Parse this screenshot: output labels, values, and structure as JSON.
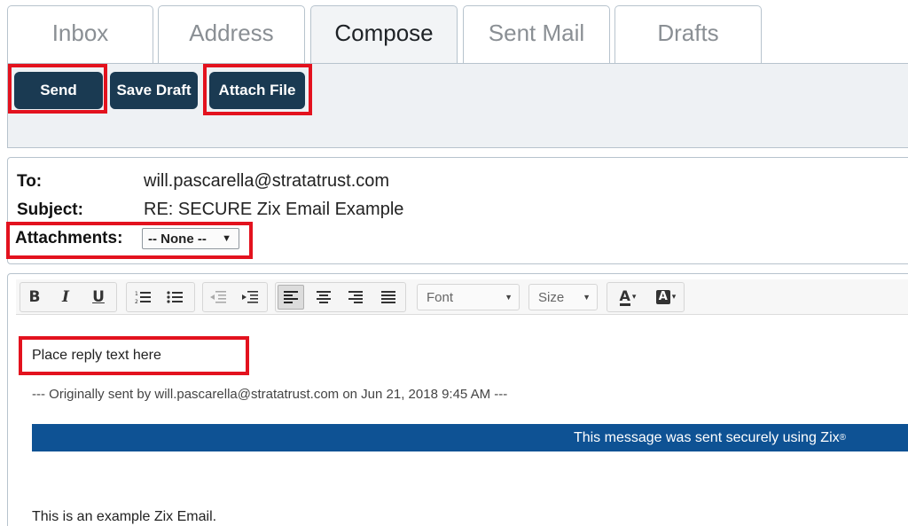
{
  "tabs": [
    {
      "label": "Inbox",
      "active": false
    },
    {
      "label": "Address",
      "active": false
    },
    {
      "label": "Compose",
      "active": true
    },
    {
      "label": "Sent Mail",
      "active": false
    },
    {
      "label": "Drafts",
      "active": false
    }
  ],
  "toolbar": {
    "send_label": "Send",
    "save_draft_label": "Save Draft",
    "attach_file_label": "Attach File"
  },
  "fields": {
    "to_label": "To:",
    "to_value": "will.pascarella@stratatrust.com",
    "subject_label": "Subject:",
    "subject_value": "RE: SECURE Zix Email Example",
    "attachments_label": "Attachments:",
    "attachments_selected": "-- None --"
  },
  "editor_toolbar": {
    "bold": "B",
    "italic": "I",
    "underline": "U",
    "font_dropdown": "Font",
    "size_dropdown": "Size",
    "text_color_glyph": "A",
    "bg_color_glyph": "A",
    "icons": [
      "ordered-list-icon",
      "unordered-list-icon",
      "outdent-icon",
      "indent-icon",
      "align-left-icon",
      "align-center-icon",
      "align-right-icon",
      "align-justify-icon",
      "text-color-icon",
      "background-color-icon"
    ]
  },
  "body": {
    "reply_placeholder": "Place reply text here",
    "original_header": "--- Originally sent by will.pascarella@stratatrust.com on Jun 21, 2018 9:45 AM ---",
    "banner_text": "This message was sent securely using Zix",
    "banner_mark": "®",
    "message_line": "This is an example Zix Email."
  },
  "colors": {
    "button_bg": "#1a3a52",
    "highlight": "#e3121e",
    "banner_bg": "#0e5294",
    "panel_border": "#b7c3cd"
  }
}
